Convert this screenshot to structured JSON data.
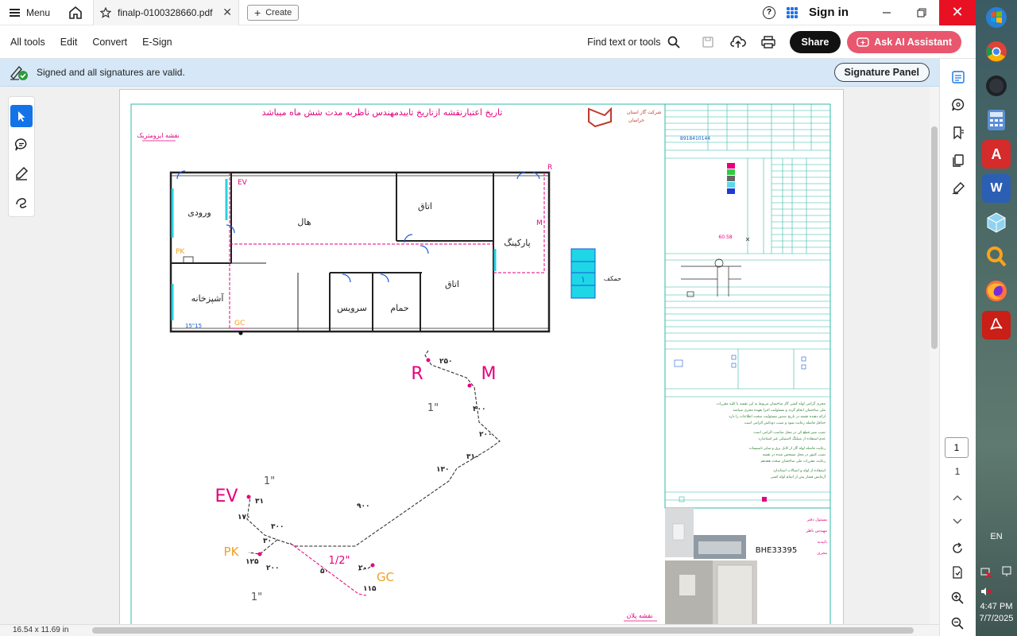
{
  "titlebar": {
    "menu_label": "Menu",
    "tab_title": "finalp-0100328660.pdf",
    "create_label": "Create",
    "signin_label": "Sign in"
  },
  "toolbar": {
    "items": [
      "All tools",
      "Edit",
      "Convert",
      "E-Sign"
    ],
    "find_label": "Find text or tools",
    "share_label": "Share",
    "ai_label": "Ask AI Assistant"
  },
  "signature": {
    "message": "Signed and all signatures are valid.",
    "panel_label": "Signature Panel"
  },
  "navigation": {
    "current_page": "1",
    "total_pages": "1"
  },
  "status": {
    "page_size": "16.54 x 11.69 in"
  },
  "drawing": {
    "header_note": "تاریخ اعتبارنقشه ازتاریخ تاییدمهندس ناظربه مدت شش ماه میباشد",
    "isometric_title": "نقشه ایزومتریک",
    "plan_title": "نقشه پلان",
    "rooms": {
      "entrance": "ورودی",
      "hall": "هال",
      "room1": "اتاق",
      "room2": "اتاق",
      "parking": "پارکینگ",
      "kitchen": "آشپزخانه",
      "wc": "سرویس",
      "bath": "حمام",
      "yard": "حمکف"
    },
    "labels": {
      "ev": "EV",
      "gc": "GC",
      "pk": "PK",
      "r": "R",
      "m": "M",
      "one_inch": "1\"",
      "half_inch": "1/2\"",
      "meter_size": "15\"15",
      "floor_num": "١",
      "code": "BHE33395",
      "value": "60.58",
      "phone": "8918410144"
    },
    "iso_dims": [
      "۲۵۰",
      "۴۰۰",
      "۲۰۰",
      "۳۱۰",
      "۱۳۰",
      "۹۰۰",
      "۳۰۰",
      "۳۰",
      "۱۷۰",
      "۳۱",
      "۱۲۵",
      "۲۰۰",
      "۵۰",
      "۱۱۵",
      "۲۰"
    ]
  },
  "taskbar": {
    "language": "EN",
    "time": "4:47 PM",
    "date": "7/7/2025"
  },
  "colors": {
    "magenta": "#e6007e",
    "teal": "#2fb8a5",
    "accent": "#1473e6",
    "ai": "#e9576e",
    "close": "#e81123"
  }
}
